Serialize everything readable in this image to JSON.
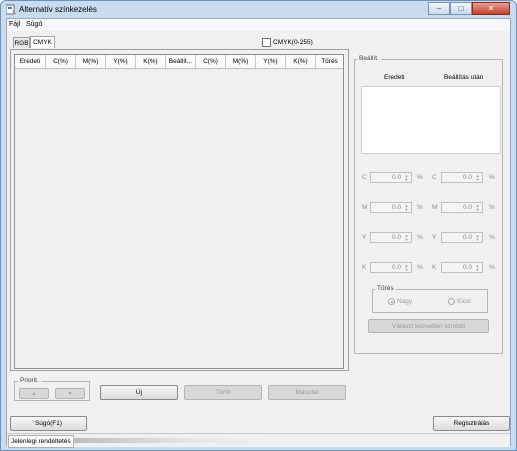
{
  "window": {
    "title": "Alternatív színkezelés",
    "caption_buttons": [
      "–",
      "□",
      "✕"
    ]
  },
  "menu": {
    "items": [
      "Fájl",
      "Súgó"
    ]
  },
  "tabs": [
    "RGB",
    "CMYK"
  ],
  "cmyk_option": {
    "label": "CMYK(0-255)",
    "checked": false
  },
  "table": {
    "columns": [
      "Eredeti",
      "C(%)",
      "M(%)",
      "Y(%)",
      "K(%)",
      "Beállít...",
      "C(%)",
      "M(%)",
      "Y(%)",
      "K(%)",
      "Tűrés"
    ],
    "rows": []
  },
  "priority": {
    "label": "Priorit.",
    "up": "▲",
    "down": "▼"
  },
  "buttons": {
    "new": "Új",
    "delete": "Töröl",
    "copy": "Másolat",
    "help": "Súgó(F1)",
    "register": "Regisztrálás",
    "select_target": "Választ közvetlen színből"
  },
  "settings": {
    "title": "Beállít.",
    "col_original": "Eredeti",
    "col_after": "Beállítás után",
    "rows": [
      {
        "label": "C",
        "orig": "0.0",
        "after": "0.0",
        "unit": "%"
      },
      {
        "label": "M",
        "orig": "0.0",
        "after": "0.0",
        "unit": "%"
      },
      {
        "label": "Y",
        "orig": "0.0",
        "after": "0.0",
        "unit": "%"
      },
      {
        "label": "K",
        "orig": "0.0",
        "after": "0.0",
        "unit": "%"
      }
    ],
    "tolerance": {
      "label": "Tűrés",
      "large": "Nagy",
      "small": "Kicsi",
      "selected": "Nagy"
    }
  },
  "status": {
    "text": "Jelenlegi rendeltetés"
  }
}
